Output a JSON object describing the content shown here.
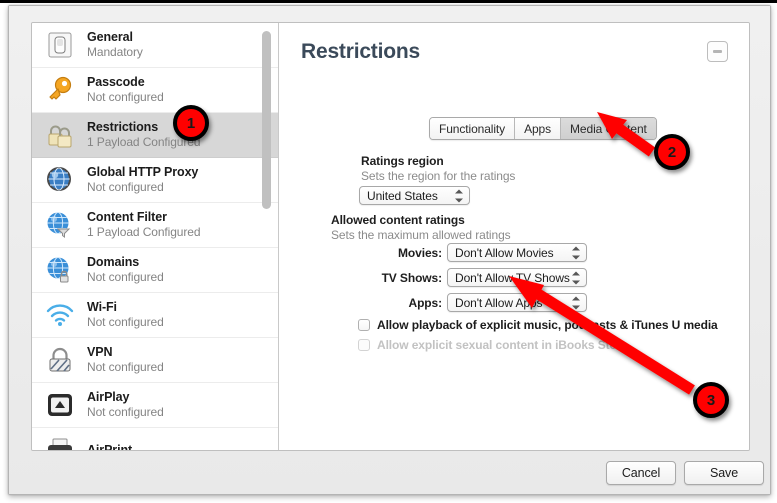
{
  "window": {
    "detail_title": "Restrictions",
    "minimize_label": "minimize"
  },
  "sidebar": {
    "items": [
      {
        "title": "General",
        "status": "Mandatory",
        "icon": "toggle-switch-icon",
        "selected": false
      },
      {
        "title": "Passcode",
        "status": "Not configured",
        "icon": "key-icon",
        "selected": false
      },
      {
        "title": "Restrictions",
        "status": "1 Payload Configured",
        "icon": "padlocks-icon",
        "selected": true
      },
      {
        "title": "Global HTTP Proxy",
        "status": "Not configured",
        "icon": "globe-gear-icon",
        "selected": false
      },
      {
        "title": "Content Filter",
        "status": "1 Payload Configured",
        "icon": "globe-funnel-icon",
        "selected": false
      },
      {
        "title": "Domains",
        "status": "Not configured",
        "icon": "globe-lock-icon",
        "selected": false
      },
      {
        "title": "Wi-Fi",
        "status": "Not configured",
        "icon": "wifi-icon",
        "selected": false
      },
      {
        "title": "VPN",
        "status": "Not configured",
        "icon": "vpn-lock-icon",
        "selected": false
      },
      {
        "title": "AirPlay",
        "status": "Not configured",
        "icon": "airplay-icon",
        "selected": false
      },
      {
        "title": "AirPrint",
        "status": "",
        "icon": "airprint-icon",
        "selected": false
      }
    ]
  },
  "tabs": [
    {
      "label": "Functionality",
      "active": false
    },
    {
      "label": "Apps",
      "active": false
    },
    {
      "label": "Media Content",
      "active": true
    }
  ],
  "form": {
    "ratings_region": {
      "label": "Ratings region",
      "sublabel": "Sets the region for the ratings",
      "value": "United States"
    },
    "allowed_ratings": {
      "label": "Allowed content ratings",
      "sublabel": "Sets the maximum allowed ratings",
      "rows": [
        {
          "label": "Movies:",
          "value": "Don't Allow Movies"
        },
        {
          "label": "TV Shows:",
          "value": "Don't Allow TV Shows"
        },
        {
          "label": "Apps:",
          "value": "Don't Allow Apps"
        }
      ]
    },
    "checkboxes": [
      {
        "label": "Allow playback of explicit music, podcasts & iTunes U media",
        "checked": false,
        "disabled": false
      },
      {
        "label": "Allow explicit sexual content in iBooks Store",
        "checked": false,
        "disabled": true
      }
    ]
  },
  "footer": {
    "cancel_label": "Cancel",
    "save_label": "Save"
  },
  "annotations": {
    "accent_color": "#ff0000",
    "badges": [
      {
        "number": "1"
      },
      {
        "number": "2"
      },
      {
        "number": "3"
      }
    ]
  }
}
